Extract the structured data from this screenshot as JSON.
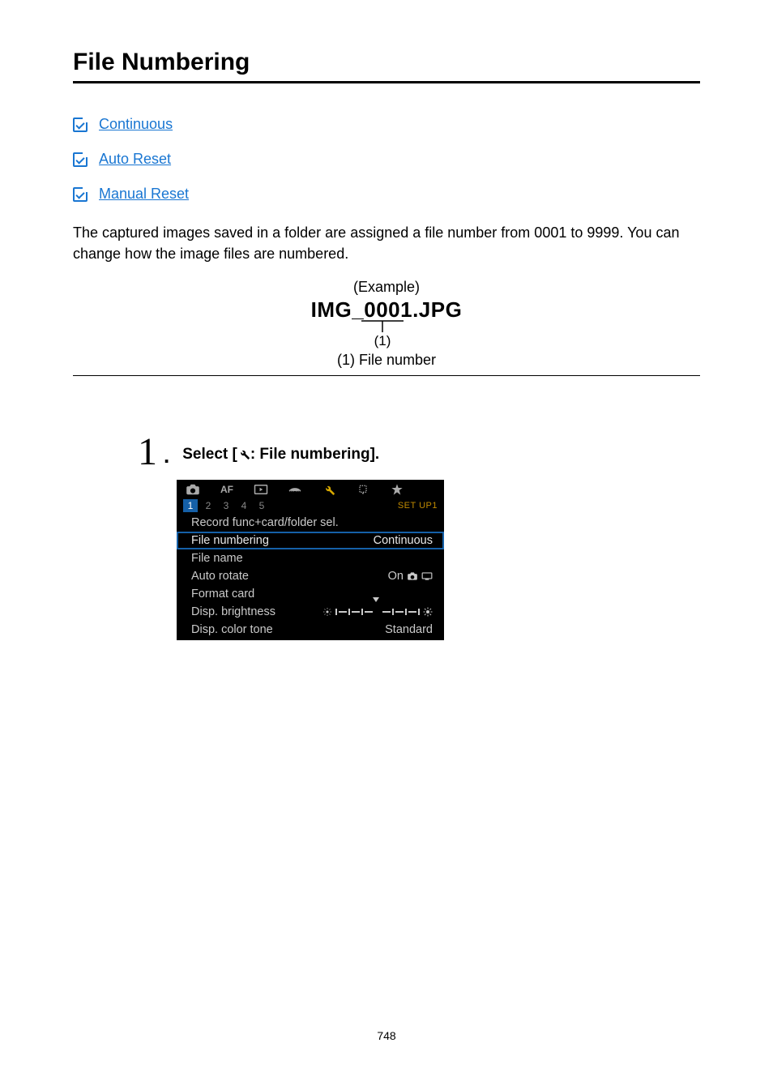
{
  "title": "File Numbering",
  "links": [
    {
      "label": "Continuous"
    },
    {
      "label": "Auto Reset"
    },
    {
      "label": "Manual Reset"
    }
  ],
  "intro": "The captured images saved in a folder are assigned a file number from 0001 to 9999. You can change how the image files are numbered.",
  "example": {
    "label": "(Example)",
    "filename": "IMG_0001.JPG",
    "pointer_legend": "(1)",
    "caption": "(1) File number"
  },
  "step": {
    "number": "1",
    "prefix": "Select [",
    "suffix": ": File numbering]."
  },
  "menu": {
    "top_tabs": [
      "camera",
      "AF",
      "play",
      "wireless",
      "wrench",
      "maint",
      "star"
    ],
    "sub_tabs": [
      "1",
      "2",
      "3",
      "4",
      "5"
    ],
    "sub_selected_index": 0,
    "sub_right_label": "SET UP1",
    "rows": [
      {
        "key": "Record func+card/folder sel.",
        "val": ""
      },
      {
        "key": "File numbering",
        "val": "Continuous",
        "selected": true
      },
      {
        "key": "File name",
        "val": ""
      },
      {
        "key": "Auto rotate",
        "val_icons": "on_cam_monitor",
        "val_prefix": "On"
      },
      {
        "key": "Format card",
        "val": ""
      },
      {
        "key": "Disp. brightness",
        "val_slider": true
      },
      {
        "key": "Disp. color tone",
        "val": "Standard"
      }
    ]
  },
  "page_number": "748"
}
